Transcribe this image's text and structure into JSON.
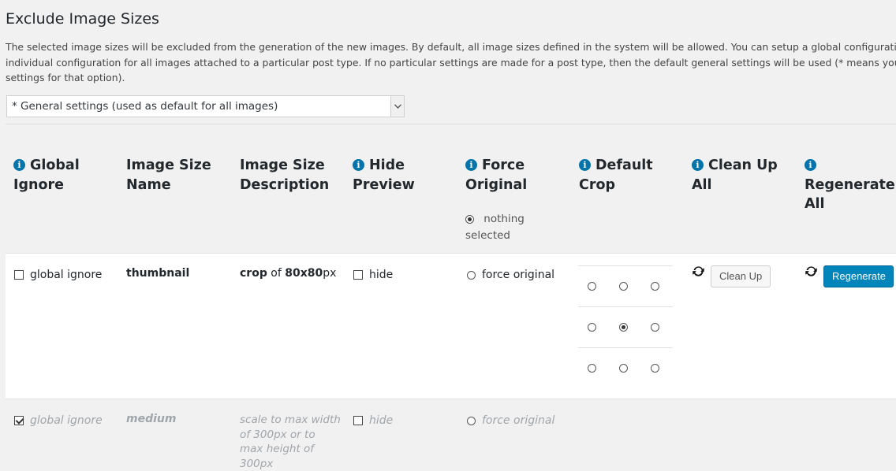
{
  "page": {
    "title": "Exclude Image Sizes",
    "description": [
      "The selected image sizes will be excluded from the generation of the new images. By default, all image sizes defined in the system will be allowed. You can setup a global configuration, or",
      "individual configuration for all images attached to a particular post type. If no particular settings are made for a post type, then the default general settings will be used (* means you added",
      "settings for that option)."
    ],
    "select_value": "* General settings (used as default for all images)"
  },
  "columns": {
    "global_ignore": [
      "Global",
      "Ignore"
    ],
    "name": [
      "Image Size",
      "Name"
    ],
    "description": [
      "Image Size",
      "Description"
    ],
    "hide_preview": [
      "Hide",
      "Preview"
    ],
    "force_original": [
      "Force",
      "Original"
    ],
    "default_crop": [
      "Default",
      "Crop"
    ],
    "clean_up_all": [
      "Clean Up",
      "All"
    ],
    "regenerate_all": [
      "",
      "Regenerate",
      "All"
    ],
    "nothing_selected": "nothing selected"
  },
  "rows": [
    {
      "global_ignore_label": "global ignore",
      "global_ignore_checked": false,
      "name": "thumbnail",
      "desc_mode": "crop",
      "desc_of": "of",
      "desc_size": "80x80",
      "desc_unit": "px",
      "hide_label": "hide",
      "force_label": "force original",
      "crop_selected": "center-center",
      "clean_up_label": "Clean Up",
      "regenerate_label": "Regenerate"
    },
    {
      "global_ignore_label": "global ignore",
      "global_ignore_checked": true,
      "name": "medium",
      "desc_lines": [
        "scale to max width",
        "of 300px or to",
        "max height of",
        "300px"
      ],
      "hide_label": "hide",
      "force_label": "force original"
    }
  ],
  "icons": {
    "info": "info-icon",
    "refresh": "refresh-icon",
    "dropdown": "chevron-down-icon"
  },
  "colors": {
    "primary": "#0085ba",
    "info": "#0073aa",
    "background": "#f1f1f1"
  }
}
